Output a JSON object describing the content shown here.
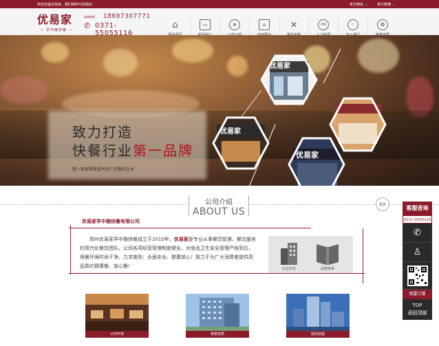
{
  "topbar": {
    "welcome": "欢迎光临优易家，我们期待与您相识",
    "link1": "官方微信",
    "link2": "官方微博"
  },
  "logo": {
    "brand": "优易家",
    "sub": "— 早中晚快餐 —"
  },
  "hotline": {
    "label": "咨询热线",
    "phone1": "18697307771",
    "phone2": "0371-55055116"
  },
  "nav": [
    {
      "label": "网站首页",
      "icon": "home-icon"
    },
    {
      "label": "新闻中心",
      "icon": "news-icon"
    },
    {
      "label": "公司介绍",
      "icon": "globe-icon"
    },
    {
      "label": "店面展示",
      "icon": "store-icon"
    },
    {
      "label": "菜品定制",
      "icon": "utensils-icon"
    },
    {
      "label": "人力资源",
      "icon": "hr-icon"
    },
    {
      "label": "加入我们",
      "icon": "handshake-icon"
    },
    {
      "label": "荣誉资质",
      "icon": "award-icon"
    }
  ],
  "banner": {
    "line1": "致力打造",
    "line2_prefix": "快餐行业",
    "line2_highlight": "第一品牌",
    "line3": "做一家值得尊重并受人信赖的企业",
    "hex_sign1": "优易家",
    "hex_sign2": "优易家",
    "hex_sign3": "优易家"
  },
  "about": {
    "title_cn": "公司介绍",
    "title_en": "ABOUT US",
    "more": "更多",
    "company": "优易家早中晚快餐有限公司",
    "intro_part1": "郑州优易家早中晚快餐成立于2010年，",
    "intro_brand": "优易家",
    "intro_part2": "是专业从事餐饮管理、餐饮服务的现代化餐饮团队。公司各项经营管理制度健全，对食品卫生安全管理严格到位，用餐环境时尚干净。力求做到：全面安全、健康放心！致力于为广大消费者提供高品质的健康餐、放心餐!",
    "culture": "企业文化",
    "story": "品牌故事"
  },
  "thumbs": [
    {
      "caption": "公司环境"
    },
    {
      "caption": "荣誉资质"
    },
    {
      "caption": "招商加盟"
    }
  ],
  "side": {
    "header": "客服咨询",
    "tel": "0371-55055116",
    "order": "我要订餐",
    "top": "TOP",
    "back": "返回顶部"
  },
  "colors": {
    "brand": "#8b1a2b",
    "highlight": "#b3121f"
  }
}
